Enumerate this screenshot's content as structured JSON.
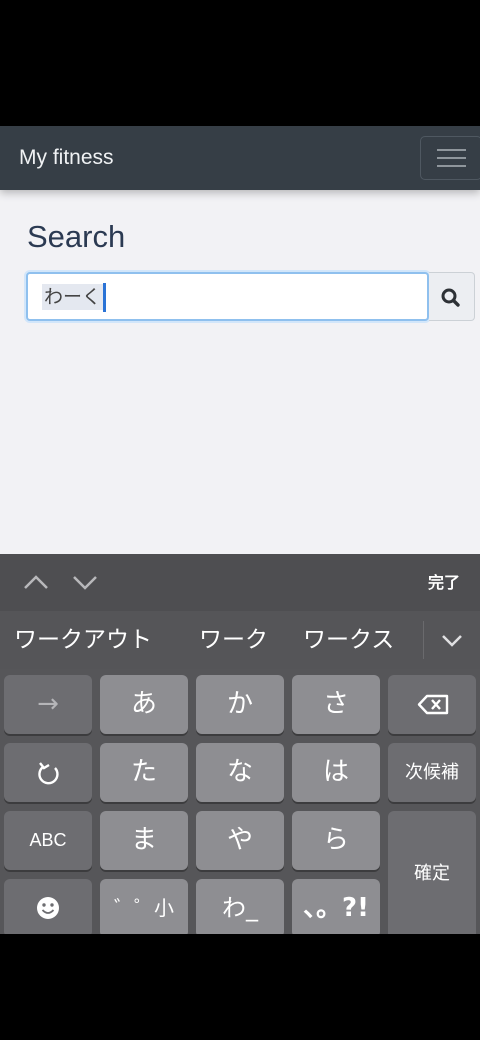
{
  "app": {
    "brand": "My fitness",
    "menu_icon": "hamburger-menu-icon"
  },
  "search": {
    "heading": "Search",
    "input_value": "わーく",
    "button_icon": "search-icon"
  },
  "keyboard": {
    "toolbar": {
      "up_icon": "chevron-up-icon",
      "down_icon": "chevron-down-icon",
      "done_label": "完了"
    },
    "candidates": [
      "ワークアウト",
      "ワーク",
      "ワークス"
    ],
    "expand_icon": "chevron-down-icon",
    "keys": {
      "arrow": "→",
      "a": "あ",
      "ka": "か",
      "sa": "さ",
      "backspace_icon": "backspace-icon",
      "undo_icon": "undo-icon",
      "ta": "た",
      "na": "な",
      "ha": "は",
      "next_candidate": "次候補",
      "abc": "ABC",
      "ma": "ま",
      "ya": "や",
      "ra": "ら",
      "confirm": "確定",
      "emoji_icon": "emoji-icon",
      "dakuten": "゛゜小",
      "wa": "わ_",
      "punct": "、。?!"
    }
  }
}
